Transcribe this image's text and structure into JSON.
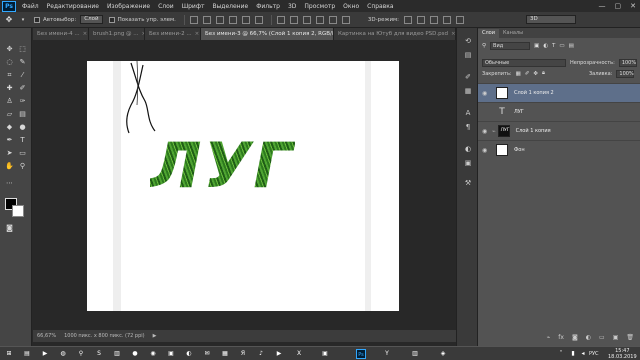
{
  "menu": {
    "logo": "Ps",
    "items": [
      "Файл",
      "Редактирование",
      "Изображение",
      "Слои",
      "Шрифт",
      "Выделение",
      "Фильтр",
      "3D",
      "Просмотр",
      "Окно",
      "Справка"
    ],
    "window_controls": [
      "—",
      "▢",
      "✕"
    ]
  },
  "options": {
    "autoselect_label": "Автовыбор:",
    "autoselect_value": "Слой",
    "show_controls_label": "Показать упр. элем.",
    "mode3d_label": "3D-режим:",
    "workspace_value": "3D"
  },
  "tabs": [
    {
      "label": "Без имени-4 ..."
    },
    {
      "label": "brush1.png @ ..."
    },
    {
      "label": "Без имени-2 ..."
    },
    {
      "label": "Без имени-3 @ 66,7% (Слой 1 копия 2, RGB/8) *"
    },
    {
      "label": "Картинка на Ютуб для видео PSD.psd"
    }
  ],
  "tab_close": "×",
  "canvas": {
    "text": "ЛУГ"
  },
  "status": {
    "zoom": "66,67%",
    "doc_info": "1000 пикс. x 800 пикс. (72 ppi)",
    "arrow": "▶"
  },
  "layers_panel": {
    "tabs": [
      "Слои",
      "Каналы"
    ],
    "filter_label": "Вид",
    "blend_mode": "Обычные",
    "opacity_label": "Непрозрачность:",
    "opacity_value": "100%",
    "lock_label": "Закрепить:",
    "fill_label": "Заливка:",
    "fill_value": "100%",
    "layers": [
      {
        "name": "Слой 1 копия 2",
        "type": "image",
        "selected": true
      },
      {
        "name": "ЛУГ",
        "type": "text",
        "selected": false
      },
      {
        "name": "Слой 1 копия",
        "type": "image-dark",
        "selected": false,
        "thumb_text": "ЛУГ"
      },
      {
        "name": "Фон",
        "type": "background",
        "selected": false
      }
    ]
  },
  "taskbar": {
    "language": "РУС",
    "time": "15:47",
    "date": "18.03.2019"
  },
  "colors": {
    "accent": "#31a8ff",
    "selected_layer": "#5e6f8a",
    "grass": "#3b8a25"
  }
}
